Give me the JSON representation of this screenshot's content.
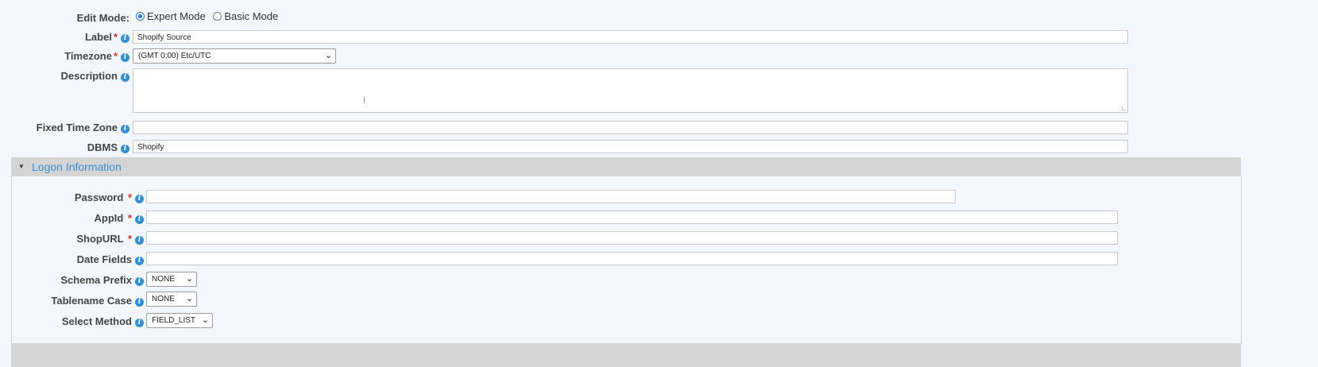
{
  "edit_mode": {
    "label": "Edit Mode:",
    "options": [
      {
        "label": "Expert Mode",
        "selected": true
      },
      {
        "label": "Basic Mode",
        "selected": false
      }
    ]
  },
  "fields": {
    "label": {
      "label": "Label",
      "required": "*",
      "value": "Shopify Source"
    },
    "timezone": {
      "label": "Timezone",
      "required": "*",
      "value": "(GMT 0:00) Etc/UTC"
    },
    "description": {
      "label": "Description",
      "value": ""
    },
    "fixed_time_zone": {
      "label": "Fixed Time Zone",
      "value": ""
    },
    "dbms": {
      "label": "DBMS",
      "value": "Shopify"
    }
  },
  "logon_section": {
    "title": "Logon Information",
    "expanded": true,
    "password": {
      "label": "Password",
      "required": "*",
      "value": ""
    },
    "app_id": {
      "label": "AppId",
      "required": "*",
      "value": ""
    },
    "shop_url": {
      "label": "ShopURL",
      "required": "*",
      "value": ""
    },
    "date_fields": {
      "label": "Date Fields",
      "value": ""
    },
    "schema_prefix": {
      "label": "Schema Prefix",
      "value": "NONE"
    },
    "tablename_case": {
      "label": "Tablename Case",
      "value": "NONE"
    },
    "select_method": {
      "label": "Select Method",
      "value": "FIELD_LIST"
    }
  },
  "icons": {
    "info": "info-icon",
    "dropdown": "chevron-down-icon",
    "collapse": "caret-down-icon"
  },
  "colors": {
    "accent": "#2f8fd8",
    "required": "#d9302c",
    "section_header_bg": "#d4d4d4",
    "page_bg": "#f3f7fb"
  }
}
